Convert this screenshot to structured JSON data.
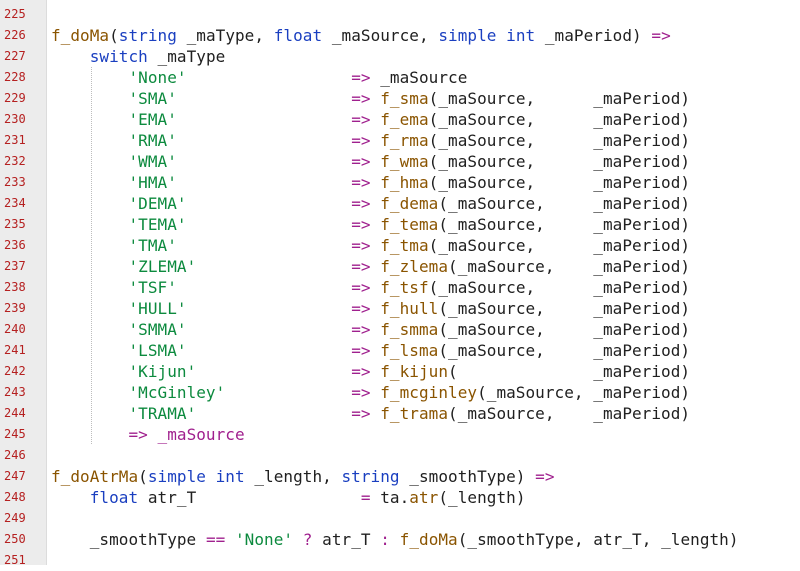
{
  "editor": {
    "colors": {
      "func": "#8a5400",
      "keyword": "#1a3fc0",
      "string": "#0c8a3e",
      "operator": "#a0208e",
      "identifier": "#202020",
      "line_number": "#b52020",
      "gutter_bg": "#ececec"
    },
    "lines": [
      {
        "num": "225",
        "tokens": []
      },
      {
        "num": "226",
        "tokens": [
          {
            "t": "f_doMa",
            "c": "func"
          },
          {
            "t": "(",
            "c": "id"
          },
          {
            "t": "string",
            "c": "kw"
          },
          {
            "t": " _maType, ",
            "c": "id"
          },
          {
            "t": "float",
            "c": "kw"
          },
          {
            "t": " _maSource, ",
            "c": "id"
          },
          {
            "t": "simple int",
            "c": "kw"
          },
          {
            "t": " _maPeriod) ",
            "c": "id"
          },
          {
            "t": "=>",
            "c": "op"
          }
        ]
      },
      {
        "num": "227",
        "tokens": [
          {
            "t": "    ",
            "c": "id"
          },
          {
            "t": "switch",
            "c": "kw"
          },
          {
            "t": " _maType",
            "c": "id"
          }
        ]
      },
      {
        "num": "228",
        "tokens": [
          {
            "t": "        ",
            "c": "id"
          },
          {
            "t": "'None'",
            "c": "str"
          },
          {
            "t": "                 ",
            "c": "id"
          },
          {
            "t": "=>",
            "c": "op"
          },
          {
            "t": " _maSource",
            "c": "id"
          }
        ]
      },
      {
        "num": "229",
        "tokens": [
          {
            "t": "        ",
            "c": "id"
          },
          {
            "t": "'SMA'",
            "c": "str"
          },
          {
            "t": "                  ",
            "c": "id"
          },
          {
            "t": "=>",
            "c": "op"
          },
          {
            "t": " ",
            "c": "id"
          },
          {
            "t": "f_sma",
            "c": "func"
          },
          {
            "t": "(_maSource,      _maPeriod)",
            "c": "id"
          }
        ]
      },
      {
        "num": "230",
        "tokens": [
          {
            "t": "        ",
            "c": "id"
          },
          {
            "t": "'EMA'",
            "c": "str"
          },
          {
            "t": "                  ",
            "c": "id"
          },
          {
            "t": "=>",
            "c": "op"
          },
          {
            "t": " ",
            "c": "id"
          },
          {
            "t": "f_ema",
            "c": "func"
          },
          {
            "t": "(_maSource,      _maPeriod)",
            "c": "id"
          }
        ]
      },
      {
        "num": "231",
        "tokens": [
          {
            "t": "        ",
            "c": "id"
          },
          {
            "t": "'RMA'",
            "c": "str"
          },
          {
            "t": "                  ",
            "c": "id"
          },
          {
            "t": "=>",
            "c": "op"
          },
          {
            "t": " ",
            "c": "id"
          },
          {
            "t": "f_rma",
            "c": "func"
          },
          {
            "t": "(_maSource,      _maPeriod)",
            "c": "id"
          }
        ]
      },
      {
        "num": "232",
        "tokens": [
          {
            "t": "        ",
            "c": "id"
          },
          {
            "t": "'WMA'",
            "c": "str"
          },
          {
            "t": "                  ",
            "c": "id"
          },
          {
            "t": "=>",
            "c": "op"
          },
          {
            "t": " ",
            "c": "id"
          },
          {
            "t": "f_wma",
            "c": "func"
          },
          {
            "t": "(_maSource,      _maPeriod)",
            "c": "id"
          }
        ]
      },
      {
        "num": "233",
        "tokens": [
          {
            "t": "        ",
            "c": "id"
          },
          {
            "t": "'HMA'",
            "c": "str"
          },
          {
            "t": "                  ",
            "c": "id"
          },
          {
            "t": "=>",
            "c": "op"
          },
          {
            "t": " ",
            "c": "id"
          },
          {
            "t": "f_hma",
            "c": "func"
          },
          {
            "t": "(_maSource,      _maPeriod)",
            "c": "id"
          }
        ]
      },
      {
        "num": "234",
        "tokens": [
          {
            "t": "        ",
            "c": "id"
          },
          {
            "t": "'DEMA'",
            "c": "str"
          },
          {
            "t": "                 ",
            "c": "id"
          },
          {
            "t": "=>",
            "c": "op"
          },
          {
            "t": " ",
            "c": "id"
          },
          {
            "t": "f_dema",
            "c": "func"
          },
          {
            "t": "(_maSource,     _maPeriod)",
            "c": "id"
          }
        ]
      },
      {
        "num": "235",
        "tokens": [
          {
            "t": "        ",
            "c": "id"
          },
          {
            "t": "'TEMA'",
            "c": "str"
          },
          {
            "t": "                 ",
            "c": "id"
          },
          {
            "t": "=>",
            "c": "op"
          },
          {
            "t": " ",
            "c": "id"
          },
          {
            "t": "f_tema",
            "c": "func"
          },
          {
            "t": "(_maSource,     _maPeriod)",
            "c": "id"
          }
        ]
      },
      {
        "num": "236",
        "tokens": [
          {
            "t": "        ",
            "c": "id"
          },
          {
            "t": "'TMA'",
            "c": "str"
          },
          {
            "t": "                  ",
            "c": "id"
          },
          {
            "t": "=>",
            "c": "op"
          },
          {
            "t": " ",
            "c": "id"
          },
          {
            "t": "f_tma",
            "c": "func"
          },
          {
            "t": "(_maSource,      _maPeriod)",
            "c": "id"
          }
        ]
      },
      {
        "num": "237",
        "tokens": [
          {
            "t": "        ",
            "c": "id"
          },
          {
            "t": "'ZLEMA'",
            "c": "str"
          },
          {
            "t": "                ",
            "c": "id"
          },
          {
            "t": "=>",
            "c": "op"
          },
          {
            "t": " ",
            "c": "id"
          },
          {
            "t": "f_zlema",
            "c": "func"
          },
          {
            "t": "(_maSource,    _maPeriod)",
            "c": "id"
          }
        ]
      },
      {
        "num": "238",
        "tokens": [
          {
            "t": "        ",
            "c": "id"
          },
          {
            "t": "'TSF'",
            "c": "str"
          },
          {
            "t": "                  ",
            "c": "id"
          },
          {
            "t": "=>",
            "c": "op"
          },
          {
            "t": " ",
            "c": "id"
          },
          {
            "t": "f_tsf",
            "c": "func"
          },
          {
            "t": "(_maSource,      _maPeriod)",
            "c": "id"
          }
        ]
      },
      {
        "num": "239",
        "tokens": [
          {
            "t": "        ",
            "c": "id"
          },
          {
            "t": "'HULL'",
            "c": "str"
          },
          {
            "t": "                 ",
            "c": "id"
          },
          {
            "t": "=>",
            "c": "op"
          },
          {
            "t": " ",
            "c": "id"
          },
          {
            "t": "f_hull",
            "c": "func"
          },
          {
            "t": "(_maSource,     _maPeriod)",
            "c": "id"
          }
        ]
      },
      {
        "num": "240",
        "tokens": [
          {
            "t": "        ",
            "c": "id"
          },
          {
            "t": "'SMMA'",
            "c": "str"
          },
          {
            "t": "                 ",
            "c": "id"
          },
          {
            "t": "=>",
            "c": "op"
          },
          {
            "t": " ",
            "c": "id"
          },
          {
            "t": "f_smma",
            "c": "func"
          },
          {
            "t": "(_maSource,     _maPeriod)",
            "c": "id"
          }
        ]
      },
      {
        "num": "241",
        "tokens": [
          {
            "t": "        ",
            "c": "id"
          },
          {
            "t": "'LSMA'",
            "c": "str"
          },
          {
            "t": "                 ",
            "c": "id"
          },
          {
            "t": "=>",
            "c": "op"
          },
          {
            "t": " ",
            "c": "id"
          },
          {
            "t": "f_lsma",
            "c": "func"
          },
          {
            "t": "(_maSource,     _maPeriod)",
            "c": "id"
          }
        ]
      },
      {
        "num": "242",
        "tokens": [
          {
            "t": "        ",
            "c": "id"
          },
          {
            "t": "'Kijun'",
            "c": "str"
          },
          {
            "t": "                ",
            "c": "id"
          },
          {
            "t": "=>",
            "c": "op"
          },
          {
            "t": " ",
            "c": "id"
          },
          {
            "t": "f_kijun",
            "c": "func"
          },
          {
            "t": "(              _maPeriod)",
            "c": "id"
          }
        ]
      },
      {
        "num": "243",
        "tokens": [
          {
            "t": "        ",
            "c": "id"
          },
          {
            "t": "'McGinley'",
            "c": "str"
          },
          {
            "t": "             ",
            "c": "id"
          },
          {
            "t": "=>",
            "c": "op"
          },
          {
            "t": " ",
            "c": "id"
          },
          {
            "t": "f_mcginley",
            "c": "func"
          },
          {
            "t": "(_maSource, _maPeriod)",
            "c": "id"
          }
        ]
      },
      {
        "num": "244",
        "tokens": [
          {
            "t": "        ",
            "c": "id"
          },
          {
            "t": "'TRAMA'",
            "c": "str"
          },
          {
            "t": "                ",
            "c": "id"
          },
          {
            "t": "=>",
            "c": "op"
          },
          {
            "t": " ",
            "c": "id"
          },
          {
            "t": "f_trama",
            "c": "func"
          },
          {
            "t": "(_maSource,    _maPeriod)",
            "c": "id"
          }
        ]
      },
      {
        "num": "245",
        "tokens": [
          {
            "t": "        ",
            "c": "id"
          },
          {
            "t": "=> _maSource",
            "c": "op"
          }
        ]
      },
      {
        "num": "246",
        "tokens": []
      },
      {
        "num": "247",
        "tokens": [
          {
            "t": "f_doAtrMa",
            "c": "func"
          },
          {
            "t": "(",
            "c": "id"
          },
          {
            "t": "simple int",
            "c": "kw"
          },
          {
            "t": " _length, ",
            "c": "id"
          },
          {
            "t": "string",
            "c": "kw"
          },
          {
            "t": " _smoothType) ",
            "c": "id"
          },
          {
            "t": "=>",
            "c": "op"
          }
        ]
      },
      {
        "num": "248",
        "tokens": [
          {
            "t": "    ",
            "c": "id"
          },
          {
            "t": "float",
            "c": "kw"
          },
          {
            "t": " atr_T                 ",
            "c": "id"
          },
          {
            "t": "=",
            "c": "op"
          },
          {
            "t": " ta.",
            "c": "id"
          },
          {
            "t": "atr",
            "c": "func"
          },
          {
            "t": "(_length)",
            "c": "id"
          }
        ]
      },
      {
        "num": "249",
        "tokens": []
      },
      {
        "num": "250",
        "tokens": [
          {
            "t": "    _smoothType ",
            "c": "id"
          },
          {
            "t": "==",
            "c": "op"
          },
          {
            "t": " ",
            "c": "id"
          },
          {
            "t": "'None'",
            "c": "str"
          },
          {
            "t": " ",
            "c": "id"
          },
          {
            "t": "?",
            "c": "op"
          },
          {
            "t": " atr_T ",
            "c": "id"
          },
          {
            "t": ":",
            "c": "op"
          },
          {
            "t": " ",
            "c": "id"
          },
          {
            "t": "f_doMa",
            "c": "func"
          },
          {
            "t": "(_smoothType, atr_T, _length)",
            "c": "id"
          }
        ]
      },
      {
        "num": "251",
        "tokens": []
      }
    ]
  }
}
